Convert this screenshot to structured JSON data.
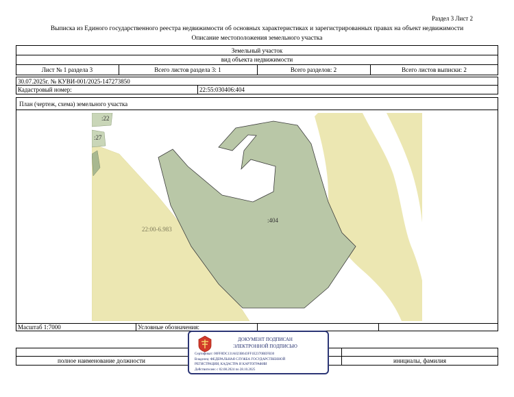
{
  "header": {
    "section_sheet": "Раздел 3   Лист 2",
    "title": "Выписка из Единого государственного реестра недвижимости об основных характеристиках и зарегистрированных правах на объект недвижимости",
    "subtitle": "Описание местоположения земельного участка"
  },
  "object": {
    "type": "Земельный участок",
    "kind_label": "вид объекта недвижимости"
  },
  "sheet_info": {
    "sheet_no": "Лист № 1 раздела 3",
    "total_sheets_section": "Всего листов раздела 3: 1",
    "total_sections": "Всего разделов: 2",
    "total_sheets_extract": "Всего листов выписки: 2"
  },
  "doc": {
    "date_number": "30.07.2025г. № КУВИ-001/2025-147273850",
    "cadastral_label": "Кадастровый номер:",
    "cadastral_value": "22:55:030406:404"
  },
  "plan": {
    "label": "План (чертеж, схема) земельного участка",
    "parcel_label": ":404",
    "lbl_22": ":22",
    "lbl_27": ":27",
    "zone_label": "22:00-6.983"
  },
  "footer": {
    "scale": "Масштаб 1:7000",
    "legend": "Условные обозначения:",
    "position_label": "полное наименование должности",
    "name_label": "инициалы, фамилия"
  },
  "stamp": {
    "line1": "ДОКУМЕНТ ПОДПИСАН",
    "line2": "ЭЛЕКТРОННОЙ ПОДПИСЬЮ",
    "cert": "Сертификат: 00FF8DC131A023B643FF1E2370BEFB30",
    "owner": "Владелец: ФЕДЕРАЛЬНАЯ СЛУЖБА ГОСУДАРСТВЕННОЙ",
    "owner2": "РЕГИСТРАЦИИ, КАДАСТРА И КАРТОГРАФИИ",
    "valid": "Действителен: с 02.08.2024 по 28.10.2025"
  },
  "colors": {
    "parcel_fill": "#b9c7a7",
    "zone_fill": "#ece7b2",
    "neighbor_fill": "#c9d6b8",
    "stamp_border": "#2b3575"
  }
}
